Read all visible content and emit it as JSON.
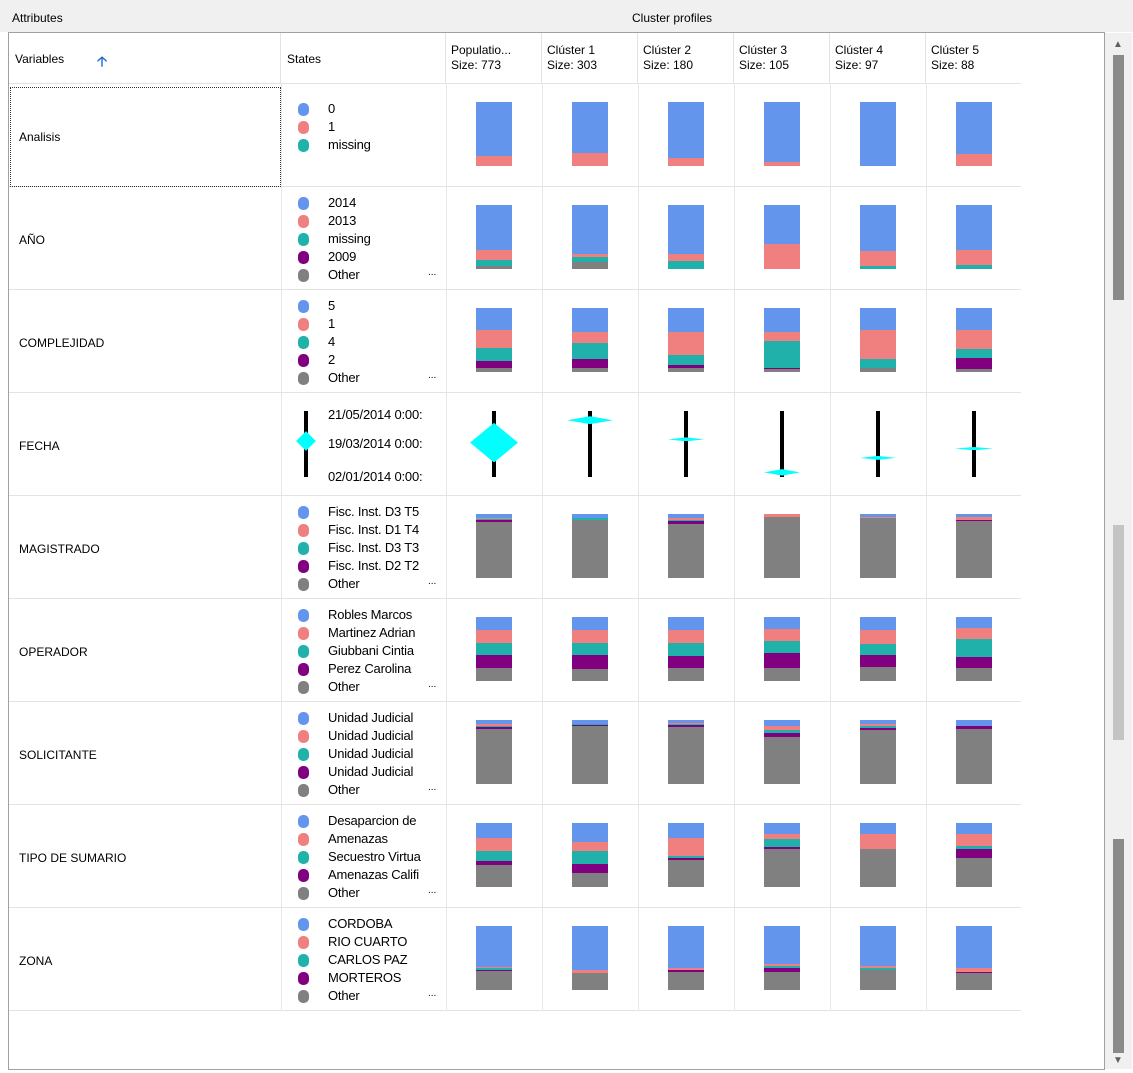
{
  "top_labels": {
    "attributes": "Attributes",
    "cluster_profiles": "Cluster profiles"
  },
  "header": {
    "variables": "Variables",
    "sort_icon": "arrow-up-icon",
    "states": "States",
    "clusters": [
      {
        "name": "Populatio...",
        "size": "Size: 773"
      },
      {
        "name": "Clúster 1",
        "size": "Size: 303"
      },
      {
        "name": "Clúster 2",
        "size": "Size: 180"
      },
      {
        "name": "Clúster 3",
        "size": "Size: 105"
      },
      {
        "name": "Clúster 4",
        "size": "Size: 97"
      },
      {
        "name": "Clúster 5",
        "size": "Size: 88"
      }
    ]
  },
  "colors": {
    "blue": "#6495ed",
    "salmon": "#f08080",
    "teal": "#20b2aa",
    "purple": "#800080",
    "gray": "#808080",
    "cyan": "#00ffff"
  },
  "rows": [
    {
      "name": "Analisis",
      "states": [
        "0",
        "1",
        "missing"
      ],
      "ellipsis": "",
      "profiles": [
        [
          0.84,
          0.16,
          0,
          0,
          0
        ],
        [
          0.79,
          0.21,
          0,
          0,
          0
        ],
        [
          0.88,
          0.12,
          0,
          0,
          0
        ],
        [
          0.93,
          0.07,
          0,
          0,
          0
        ],
        [
          1,
          0,
          0,
          0,
          0
        ],
        [
          0.82,
          0.18,
          0,
          0,
          0
        ]
      ]
    },
    {
      "name": "AÑO",
      "states": [
        "2014",
        "2013",
        "missing",
        "2009",
        "Other"
      ],
      "ellipsis": "...",
      "profiles": [
        [
          0.71,
          0.15,
          0.1,
          0,
          0.04
        ],
        [
          0.77,
          0.05,
          0.07,
          0,
          0.11
        ],
        [
          0.77,
          0.1,
          0.13,
          0,
          0
        ],
        [
          0.61,
          0.39,
          0,
          0,
          0
        ],
        [
          0.72,
          0.23,
          0.05,
          0,
          0
        ],
        [
          0.7,
          0.24,
          0.06,
          0,
          0
        ]
      ]
    },
    {
      "name": "COMPLEJIDAD",
      "states": [
        "5",
        "1",
        "4",
        "2",
        "Other"
      ],
      "ellipsis": "...",
      "profiles": [
        [
          0.34,
          0.28,
          0.21,
          0.11,
          0.06
        ],
        [
          0.38,
          0.16,
          0.25,
          0.15,
          0.06
        ],
        [
          0.38,
          0.36,
          0.15,
          0.05,
          0.06
        ],
        [
          0.37,
          0.15,
          0.41,
          0.03,
          0.04
        ],
        [
          0.34,
          0.45,
          0.15,
          0,
          0.06
        ],
        [
          0.34,
          0.3,
          0.14,
          0.17,
          0.05
        ]
      ]
    },
    {
      "name": "FECHA",
      "type": "date",
      "labels": [
        "21/05/2014 0:00:",
        "19/03/2014 0:00:",
        "02/01/2014 0:00:"
      ],
      "profiles": [
        {
          "pos": 0.48,
          "h": 0.6,
          "w": 1.0
        },
        {
          "pos": 0.48,
          "h": 0.6,
          "w": 1.0
        },
        {
          "pos": 0.14,
          "h": 0.12,
          "w": 0.95
        },
        {
          "pos": 0.43,
          "h": 0.06,
          "w": 0.75
        },
        {
          "pos": 0.93,
          "h": 0.1,
          "w": 0.75
        },
        {
          "pos": 0.71,
          "h": 0.06,
          "w": 0.75
        },
        {
          "pos": 0.57,
          "h": 0.05,
          "w": 0.8
        }
      ]
    },
    {
      "name": "MAGISTRADO",
      "states": [
        "Fisc. Inst. D3 T5",
        "Fisc. Inst. D1 T4",
        "Fisc. Inst. D3 T3",
        "Fisc. Inst. D2 T2",
        "Other"
      ],
      "ellipsis": "...",
      "profiles": [
        [
          0.06,
          0.02,
          0.02,
          0.03,
          0.87
        ],
        [
          0.06,
          0.01,
          0.02,
          0.01,
          0.9
        ],
        [
          0.06,
          0.04,
          0.01,
          0.04,
          0.85
        ],
        [
          0,
          0.04,
          0,
          0.01,
          0.95
        ],
        [
          0.05,
          0.01,
          0.01,
          0,
          0.93
        ],
        [
          0.05,
          0.04,
          0,
          0.02,
          0.89
        ]
      ]
    },
    {
      "name": "OPERADOR",
      "states": [
        "Robles Marcos",
        "Martinez Adrian",
        "Giubbani Cintia",
        "Perez Carolina",
        "Other"
      ],
      "ellipsis": "...",
      "profiles": [
        [
          0.2,
          0.21,
          0.19,
          0.19,
          0.21
        ],
        [
          0.2,
          0.21,
          0.19,
          0.21,
          0.19
        ],
        [
          0.2,
          0.2,
          0.21,
          0.19,
          0.2
        ],
        [
          0.19,
          0.19,
          0.19,
          0.22,
          0.21
        ],
        [
          0.2,
          0.22,
          0.18,
          0.18,
          0.22
        ],
        [
          0.17,
          0.17,
          0.28,
          0.17,
          0.21
        ]
      ]
    },
    {
      "name": "SOLICITANTE",
      "states": [
        "Unidad Judicial",
        "Unidad Judicial",
        "Unidad Judicial",
        "Unidad Judicial",
        "Other"
      ],
      "ellipsis": "...",
      "profiles": [
        [
          0.07,
          0.02,
          0.02,
          0.03,
          0.86
        ],
        [
          0.06,
          0.01,
          0.01,
          0.01,
          0.91
        ],
        [
          0.05,
          0.02,
          0.01,
          0.03,
          0.89
        ],
        [
          0.09,
          0.06,
          0.06,
          0.05,
          0.74
        ],
        [
          0.07,
          0.03,
          0.03,
          0.03,
          0.84
        ],
        [
          0.09,
          0.01,
          0,
          0.04,
          0.86
        ]
      ]
    },
    {
      "name": "TIPO DE SUMARIO",
      "states": [
        "Desaparcion de",
        "Amenazas",
        "Secuestro Virtua",
        "Amenazas Califi",
        "Other"
      ],
      "ellipsis": "...",
      "profiles": [
        [
          0.23,
          0.21,
          0.15,
          0.06,
          0.35
        ],
        [
          0.29,
          0.15,
          0.2,
          0.14,
          0.22
        ],
        [
          0.24,
          0.27,
          0.04,
          0.03,
          0.42
        ],
        [
          0.17,
          0.08,
          0.12,
          0.03,
          0.6
        ],
        [
          0.17,
          0.23,
          0,
          0,
          0.6
        ],
        [
          0.17,
          0.19,
          0.05,
          0.14,
          0.45
        ]
      ]
    },
    {
      "name": "ZONA",
      "states": [
        "CORDOBA",
        "RIO CUARTO",
        "CARLOS PAZ",
        "MORTEROS",
        "Other"
      ],
      "ellipsis": "...",
      "profiles": [
        [
          0.64,
          0.02,
          0.02,
          0.02,
          0.3
        ],
        [
          0.68,
          0.06,
          0,
          0,
          0.26
        ],
        [
          0.65,
          0.03,
          0.01,
          0.03,
          0.28
        ],
        [
          0.6,
          0.03,
          0.03,
          0.06,
          0.28
        ],
        [
          0.62,
          0.03,
          0.04,
          0,
          0.31
        ],
        [
          0.66,
          0.06,
          0,
          0.01,
          0.27
        ]
      ]
    }
  ]
}
